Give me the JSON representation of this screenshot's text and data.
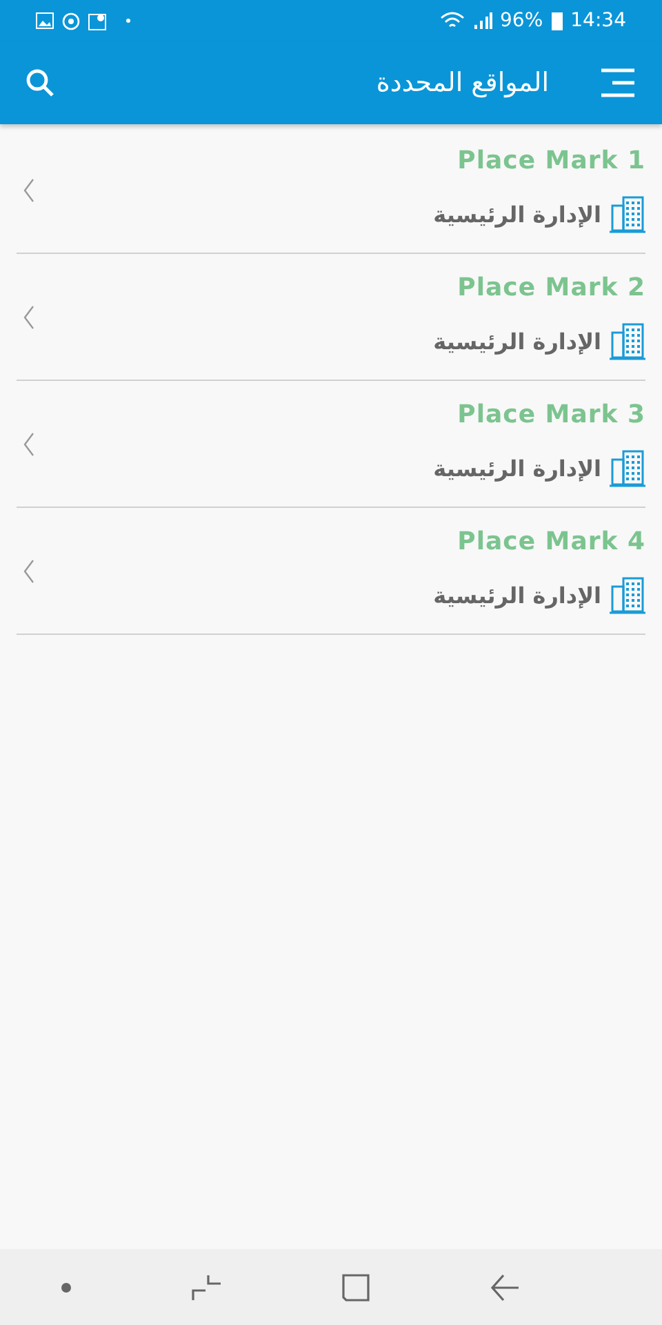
{
  "status_bar": {
    "battery": "96%",
    "time": "14:34"
  },
  "app_bar": {
    "title": "المواقع المحددة"
  },
  "places": [
    {
      "name": "Place Mark 1",
      "location": "الإدارة الرئيسية"
    },
    {
      "name": "Place Mark 2",
      "location": "الإدارة الرئيسية"
    },
    {
      "name": "Place Mark 3",
      "location": "الإدارة الرئيسية"
    },
    {
      "name": "Place Mark 4",
      "location": "الإدارة الرئيسية"
    }
  ]
}
